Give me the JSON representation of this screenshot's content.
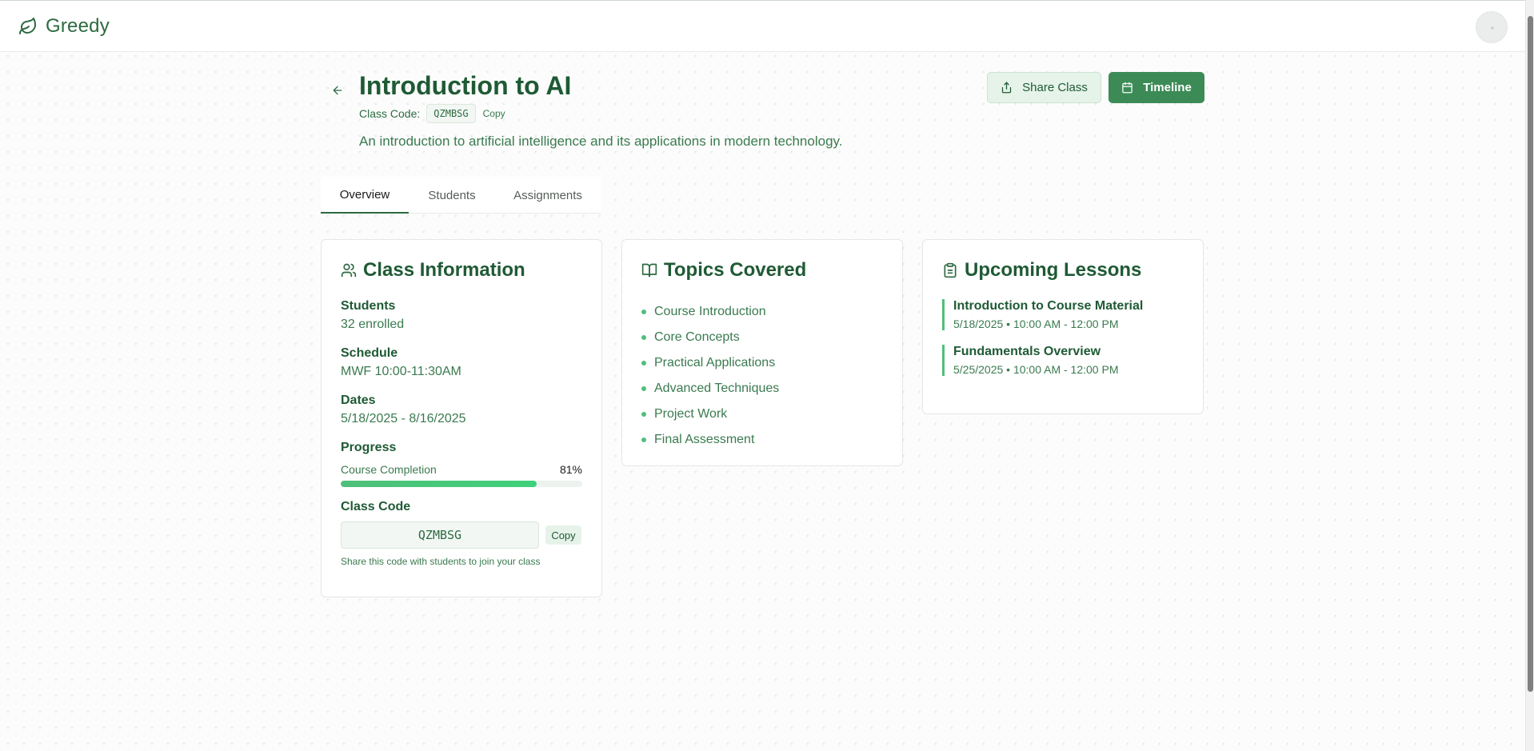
{
  "app": {
    "brand": "Greedy"
  },
  "class": {
    "title": "Introduction to AI",
    "code_label": "Class Code:",
    "code": "QZMBSG",
    "copy_label": "Copy",
    "description": "An introduction to artificial intelligence and its applications in modern technology."
  },
  "actions": {
    "share_label": "Share Class",
    "timeline_label": "Timeline"
  },
  "tabs": [
    {
      "label": "Overview",
      "active": true
    },
    {
      "label": "Students",
      "active": false
    },
    {
      "label": "Assignments",
      "active": false
    }
  ],
  "info_card": {
    "title": "Class Information",
    "students_label": "Students",
    "students_value": "32 enrolled",
    "schedule_label": "Schedule",
    "schedule_value": "MWF 10:00-11:30AM",
    "dates_label": "Dates",
    "dates_value": "5/18/2025 - 8/16/2025",
    "progress_label": "Progress",
    "progress_name": "Course Completion",
    "progress_text": "81%",
    "progress_fraction": 0.81,
    "code_label": "Class Code",
    "code_value": "QZMBSG",
    "copy_label": "Copy",
    "hint": "Share this code with students to join your class"
  },
  "topics_card": {
    "title": "Topics Covered",
    "items": [
      "Course Introduction",
      "Core Concepts",
      "Practical Applications",
      "Advanced Techniques",
      "Project Work",
      "Final Assessment"
    ]
  },
  "lessons_card": {
    "title": "Upcoming Lessons",
    "items": [
      {
        "title": "Introduction to Course Material",
        "time": "5/18/2025 • 10:00 AM - 12:00 PM"
      },
      {
        "title": "Fundamentals Overview",
        "time": "5/25/2025 • 10:00 AM - 12:00 PM"
      }
    ]
  },
  "colors": {
    "primary": "#3c8b57",
    "text": "#1f5a35",
    "accent": "#4fbf7a",
    "soft": "#e6f3e9"
  }
}
